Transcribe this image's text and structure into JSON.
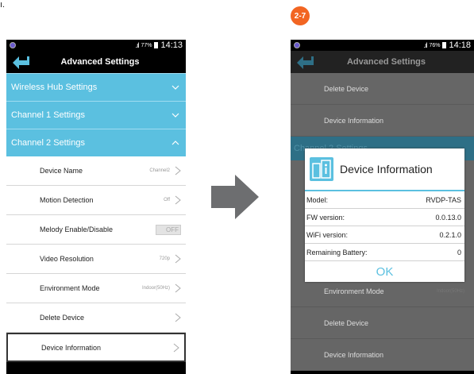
{
  "corner_mark": "ı.",
  "step_badge": "2-7",
  "left_screen": {
    "status": {
      "signal": ".ıl",
      "battery_pct": "77%",
      "time": "14:13"
    },
    "title": "Advanced Settings",
    "sections": [
      {
        "label": "Wireless Hub Settings"
      },
      {
        "label": "Channel 1 Settings"
      },
      {
        "label": "Channel 2 Settings"
      }
    ],
    "items": [
      {
        "label": "Device Name",
        "value": "Channel2"
      },
      {
        "label": "Motion Detection",
        "value": "Off"
      },
      {
        "label": "Melody Enable/Disable",
        "toggle": "OFF"
      },
      {
        "label": "Video Resolution",
        "value": "720p"
      },
      {
        "label": "Environment Mode",
        "value": "Indoor(50Hz)"
      },
      {
        "label": "Delete Device",
        "value": ""
      },
      {
        "label": "Device Information",
        "value": ""
      }
    ]
  },
  "right_screen": {
    "status": {
      "signal": ".ıl",
      "battery_pct": "76%",
      "time": "14:18"
    },
    "title": "Advanced Settings",
    "top_items": [
      {
        "label": "Delete Device"
      },
      {
        "label": "Device Information"
      }
    ],
    "section": "Channel 2 Settings",
    "bottom_items": [
      {
        "label": "Environment Mode",
        "value": "Indoor(50Hz)"
      },
      {
        "label": "Delete Device"
      },
      {
        "label": "Device Information"
      }
    ],
    "dialog": {
      "title": "Device Information",
      "rows": [
        {
          "label": "Model:",
          "value": "RVDP-TAS"
        },
        {
          "label": "FW version:",
          "value": "0.0.13.0"
        },
        {
          "label": "WiFi version:",
          "value": "0.2.1.0"
        },
        {
          "label": "Remaining Battery:",
          "value": "0"
        }
      ],
      "ok": "OK"
    }
  },
  "colors": {
    "accent": "#5bc0e0",
    "badge": "#f26522",
    "arrow": "#6d6e70"
  }
}
